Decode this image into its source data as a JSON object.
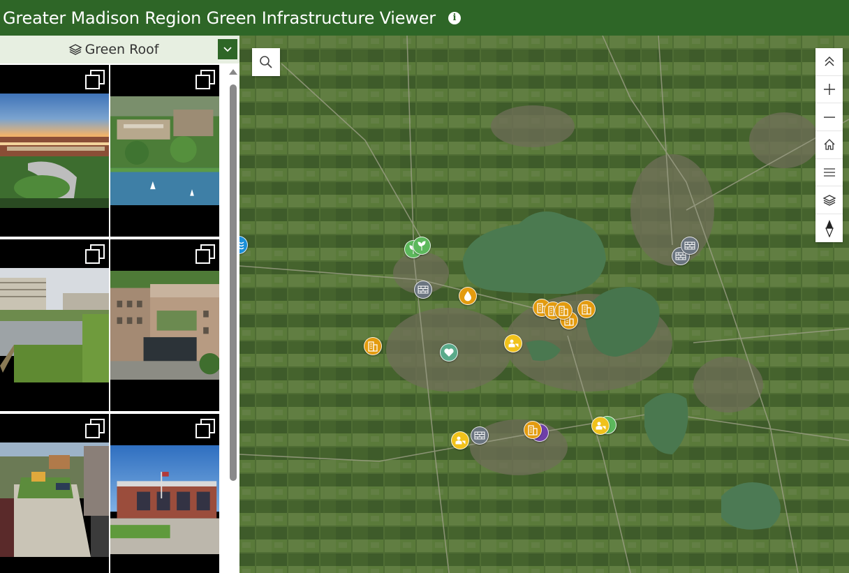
{
  "header": {
    "title": "Greater Madison Region Green Infrastructure Viewer",
    "info_icon": "info-icon"
  },
  "sidebar": {
    "layer_label": "Green Roof",
    "layer_icon": "layers-icon",
    "dropdown_icon": "chevron-down-icon",
    "gallery": [
      {
        "photo": "campus-building-sunset",
        "action_icon": "expand-icon"
      },
      {
        "photo": "campus-aerial-lakeshore",
        "action_icon": "expand-icon"
      },
      {
        "photo": "rooftop-garden-terrace",
        "action_icon": "expand-icon"
      },
      {
        "photo": "brick-building-green-roof",
        "action_icon": "expand-icon"
      },
      {
        "photo": "urban-rooftop-garden",
        "action_icon": "expand-icon"
      },
      {
        "photo": "fire-station-building",
        "action_icon": "expand-icon"
      }
    ]
  },
  "map": {
    "search_icon": "search-icon",
    "tools": [
      "collapse-icon",
      "zoom-in-icon",
      "zoom-out-icon",
      "home-icon",
      "legend-list-icon",
      "basemap-layers-icon",
      "compass-icon"
    ],
    "colors": {
      "orange": "#e39b0f",
      "yellow": "#f0c21b",
      "gray": "#6b7580",
      "green": "#5cb85c",
      "teal": "#5aaa8a",
      "blue": "#1a8fd8",
      "purple": "#6e3fa8"
    }
  }
}
